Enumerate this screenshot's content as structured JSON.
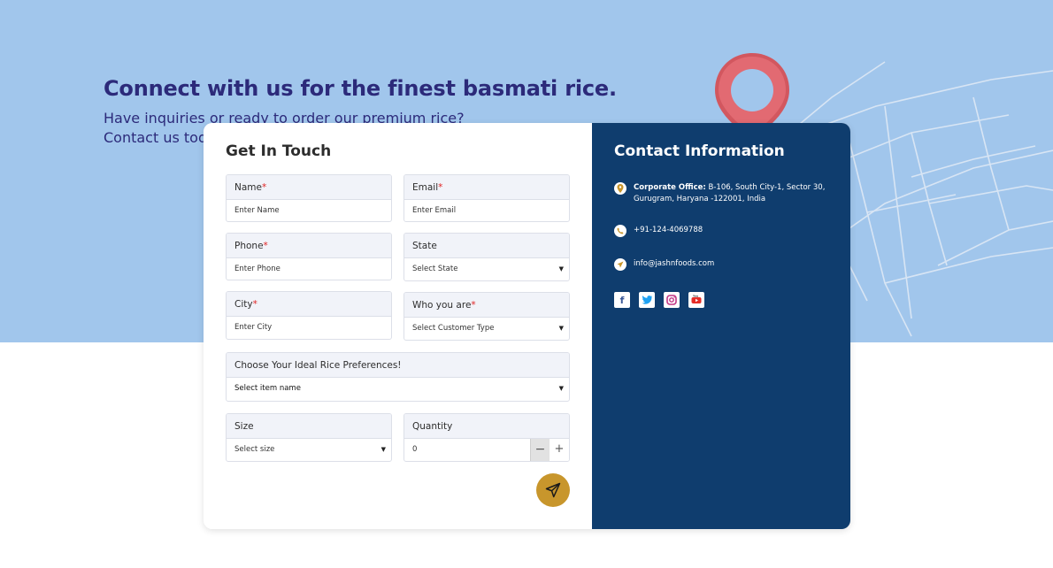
{
  "hero": {
    "title": "Connect with us for the finest basmati rice.",
    "subtitle_line1": "Have inquiries or ready to order our premium rice?",
    "subtitle_line2": "Contact us today"
  },
  "form": {
    "title": "Get In Touch",
    "required_mark": "*",
    "name": {
      "label": "Name",
      "placeholder": "Enter Name"
    },
    "email": {
      "label": "Email",
      "placeholder": "Enter Email"
    },
    "phone": {
      "label": "Phone",
      "placeholder": "Enter Phone"
    },
    "state": {
      "label": "State",
      "value": "Select State"
    },
    "city": {
      "label": "City",
      "placeholder": "Enter City"
    },
    "who": {
      "label": "Who you are",
      "value": "Select Customer Type"
    },
    "rice": {
      "label": "Choose Your Ideal Rice Preferences!",
      "value": "Select item name"
    },
    "size": {
      "label": "Size",
      "value": "Select size"
    },
    "quantity": {
      "label": "Quantity",
      "value": "0",
      "minus": "−",
      "plus": "+"
    }
  },
  "contact": {
    "title": "Contact Information",
    "office_label": "Corporate Office:",
    "office_text": "B-106, South City-1, Sector 30, Gurugram, Haryana -122001, India",
    "phone": "+91-124-4069788",
    "email": "info@jashnfoods.com",
    "socials": [
      "facebook-icon",
      "twitter-icon",
      "instagram-icon",
      "youtube-icon"
    ]
  },
  "colors": {
    "hero_bg": "#a1c6ec",
    "title": "#2c2a7a",
    "info_bg": "#0f3d6e",
    "send_button": "#c8962c",
    "required": "#e02424"
  }
}
